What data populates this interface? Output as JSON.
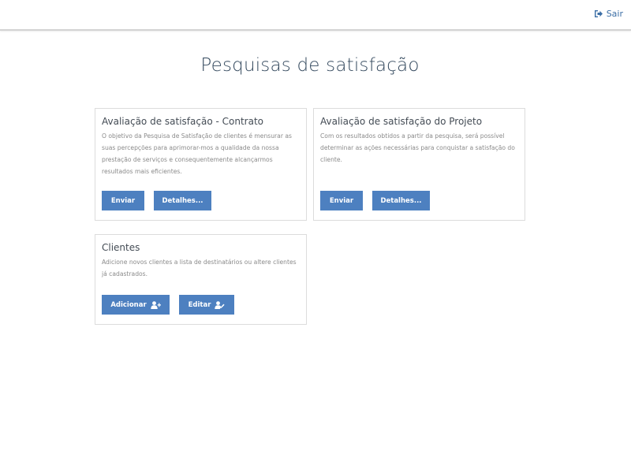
{
  "header": {
    "logout_label": "Sair",
    "logout_icon": "sign-out-icon"
  },
  "page": {
    "title": "Pesquisas de satisfação"
  },
  "cards": [
    {
      "title": "Avaliação de satisfação - Contrato",
      "description": "O objetivo da Pesquisa de Satisfação de clientes é mensurar as suas percepções para aprimorar-mos a qualidade da nossa prestação de serviços e consequentemente alcançarmos resultados mais eficientes.",
      "buttons": [
        {
          "label": "Enviar"
        },
        {
          "label": "Detalhes..."
        }
      ]
    },
    {
      "title": "Avaliação de satisfação do Projeto",
      "description": "Com os resultados obtidos a partir da pesquisa, será possível determinar as ações necessárias para conquistar a satisfação do cliente.",
      "buttons": [
        {
          "label": "Enviar"
        },
        {
          "label": "Detalhes..."
        }
      ]
    },
    {
      "title": "Clientes",
      "description": "Adicione novos clientes a lista de destinatários ou altere clientes já cadastrados.",
      "buttons": [
        {
          "label": "Adicionar",
          "icon": "user-plus-icon"
        },
        {
          "label": "Editar",
          "icon": "user-edit-icon"
        }
      ]
    }
  ],
  "colors": {
    "accent": "#4d80c0",
    "link": "#3b6ea5",
    "title": "#34495e"
  }
}
